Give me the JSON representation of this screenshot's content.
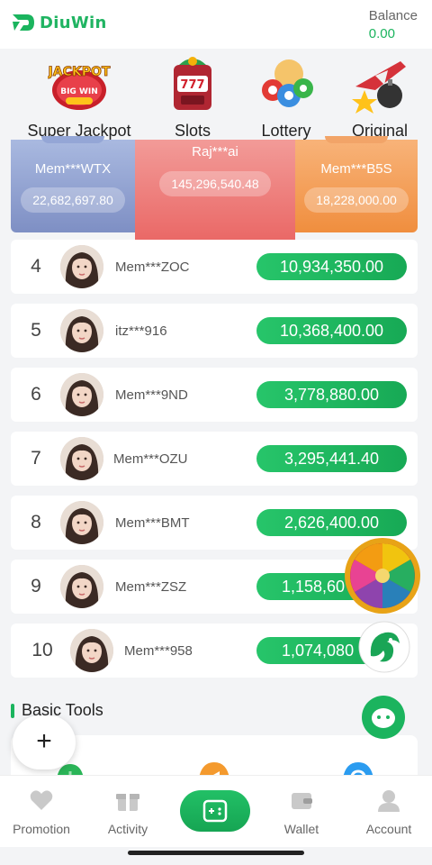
{
  "header": {
    "logo_text": "DiuWin",
    "balance_label": "Balance",
    "balance_value": "0.00"
  },
  "categories": [
    {
      "label": "Super Jackpot",
      "icon": "jackpot-icon"
    },
    {
      "label": "Slots",
      "icon": "slot-machine-icon"
    },
    {
      "label": "Lottery",
      "icon": "lottery-balls-icon"
    },
    {
      "label": "Original",
      "icon": "plane-bomb-icon"
    }
  ],
  "podium": {
    "second": {
      "name": "Mem***WTX",
      "amount": "22,682,697.80"
    },
    "first": {
      "name": "Raj***ai",
      "amount": "145,296,540.48"
    },
    "third": {
      "name": "Mem***B5S",
      "amount": "18,228,000.00"
    }
  },
  "rankings": [
    {
      "rank": "4",
      "name": "Mem***ZOC",
      "amount": "10,934,350.00"
    },
    {
      "rank": "5",
      "name": "itz***916",
      "amount": "10,368,400.00"
    },
    {
      "rank": "6",
      "name": "Mem***9ND",
      "amount": "3,778,880.00"
    },
    {
      "rank": "7",
      "name": "Mem***OZU",
      "amount": "3,295,441.40"
    },
    {
      "rank": "8",
      "name": "Mem***BMT",
      "amount": "2,626,400.00"
    },
    {
      "rank": "9",
      "name": "Mem***ZSZ",
      "amount": "1,158,60"
    },
    {
      "rank": "10",
      "name": "Mem***958",
      "amount": "1,074,080"
    }
  ],
  "tools": {
    "title": "Basic Tools"
  },
  "fab": {
    "add_label": "+"
  },
  "bottom_nav": [
    {
      "label": "Promotion",
      "icon": "promotion-icon"
    },
    {
      "label": "Activity",
      "icon": "gift-icon"
    },
    {
      "label": "",
      "icon": "game-controller-icon"
    },
    {
      "label": "Wallet",
      "icon": "wallet-icon"
    },
    {
      "label": "Account",
      "icon": "account-icon"
    }
  ],
  "colors": {
    "brand_green": "#1bb45e",
    "podium_second": "#8e9fd0",
    "podium_first": "#ec7472",
    "podium_third": "#f39a52"
  }
}
